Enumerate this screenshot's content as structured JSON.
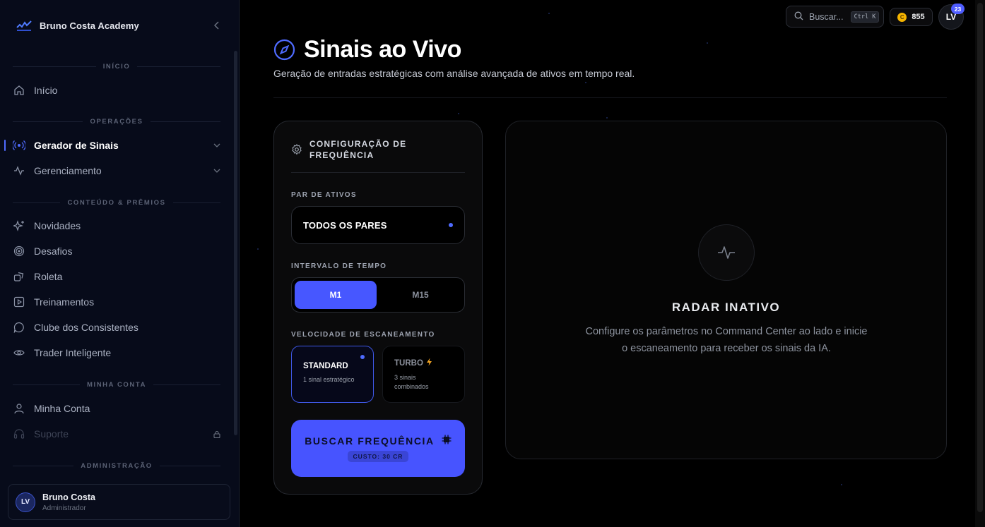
{
  "brand": {
    "name": "Bruno Costa Academy"
  },
  "sidebar": {
    "sections": {
      "inicio": "INÍCIO",
      "operacoes": "OPERAÇÕES",
      "conteudo": "CONTEÚDO & PRÊMIOS",
      "minha_conta": "MINHA CONTA",
      "administracao": "ADMINISTRAÇÃO"
    },
    "items": {
      "inicio": "Início",
      "gerador": "Gerador de Sinais",
      "gerenciamento": "Gerenciamento",
      "novidades": "Novidades",
      "desafios": "Desafios",
      "roleta": "Roleta",
      "treinamentos": "Treinamentos",
      "clube": "Clube dos Consistentes",
      "trader": "Trader Inteligente",
      "minha_conta": "Minha Conta",
      "suporte": "Suporte"
    },
    "user": {
      "initials": "LV",
      "name": "Bruno Costa",
      "role": "Administrador"
    }
  },
  "header": {
    "search_placeholder": "Buscar...",
    "search_shortcut": "Ctrl K",
    "coin_symbol": "C",
    "coins": "855",
    "level_initials": "LV",
    "level_badge": "23"
  },
  "page": {
    "title": "Sinais ao Vivo",
    "subtitle": "Geração de entradas estratégicas com análise avançada de ativos em tempo real."
  },
  "config": {
    "title": "CONFIGURAÇÃO DE FREQUÊNCIA",
    "pair_label": "PAR DE ATIVOS",
    "pair_value": "TODOS OS PARES",
    "interval_label": "INTERVALO DE TEMPO",
    "interval_options": [
      "M1",
      "M15"
    ],
    "speed_label": "VELOCIDADE DE ESCANEAMENTO",
    "standard_name": "STANDARD",
    "standard_desc": "1 sinal estratégico",
    "turbo_name": "TURBO",
    "turbo_desc": "3 sinais combinados",
    "button_label": "BUSCAR FREQUÊNCIA",
    "button_cost": "CUSTO: 30 CR"
  },
  "radar": {
    "title": "RADAR INATIVO",
    "text": "Configure os parâmetros no Command Center ao lado e inicie o escaneamento para receber os sinais da IA."
  },
  "colors": {
    "accent": "#4754ff",
    "background": "#000000",
    "sidebar": "#070b1a"
  }
}
